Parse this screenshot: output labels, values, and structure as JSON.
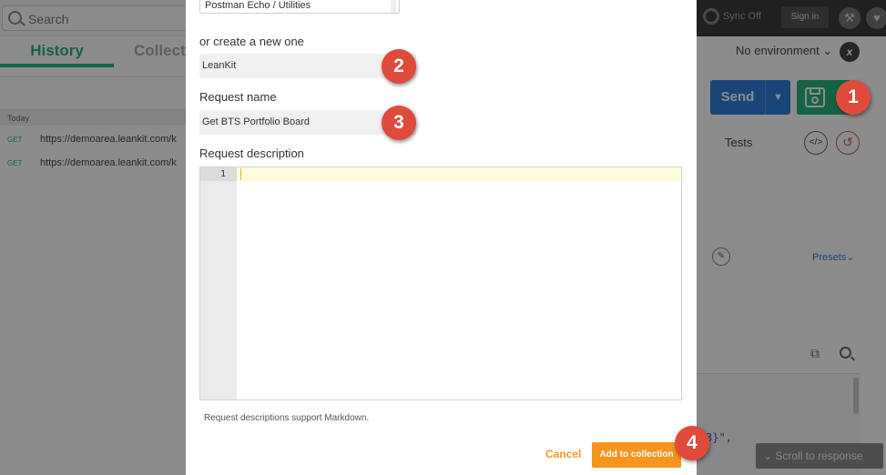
{
  "topbar": {
    "search_placeholder": "Search",
    "sync_label": "Sync Off",
    "signin_label": "Sign in"
  },
  "sidebar": {
    "tabs": [
      {
        "label": "History"
      },
      {
        "label": "Collecti"
      }
    ],
    "group_label": "Today",
    "history": [
      {
        "method": "GET",
        "url": "https://demoarea.leankit.com/k"
      },
      {
        "method": "GET",
        "url": "https://demoarea.leankit.com/k"
      }
    ]
  },
  "builder": {
    "environment": "No environment",
    "env_icon": "x",
    "send_label": "Send",
    "tests_tab": "Tests",
    "presets_label": "Presets",
    "response_snippet": "3}\",",
    "scroll_to_response": "Scroll to response"
  },
  "modal": {
    "collection_value": "Postman Echo / Utilities",
    "create_new_label": "or create a new one",
    "new_collection_value": "LeanKit",
    "request_name_label": "Request name",
    "request_name_value": "Get BTS Portfolio Board",
    "description_label": "Request description",
    "editor_line_number": "1",
    "markdown_hint": "Request descriptions support Markdown.",
    "cancel_label": "Cancel",
    "add_label": "Add to collection"
  },
  "badges": [
    "1",
    "2",
    "3",
    "4"
  ],
  "colors": {
    "accent_green": "#26b47f",
    "send_blue": "#2e7fd9",
    "cancel_orange": "#f39a1e",
    "add_button_orange": "#f7941d",
    "badge_red": "#e04a3a"
  },
  "icons": [
    "search-icon",
    "sync-icon",
    "wrench-icon",
    "heart-icon",
    "environment-x-icon",
    "chevron-down-icon",
    "save-icon",
    "code-icon",
    "undo-icon",
    "pencil-icon",
    "copy-icon",
    "find-icon"
  ]
}
